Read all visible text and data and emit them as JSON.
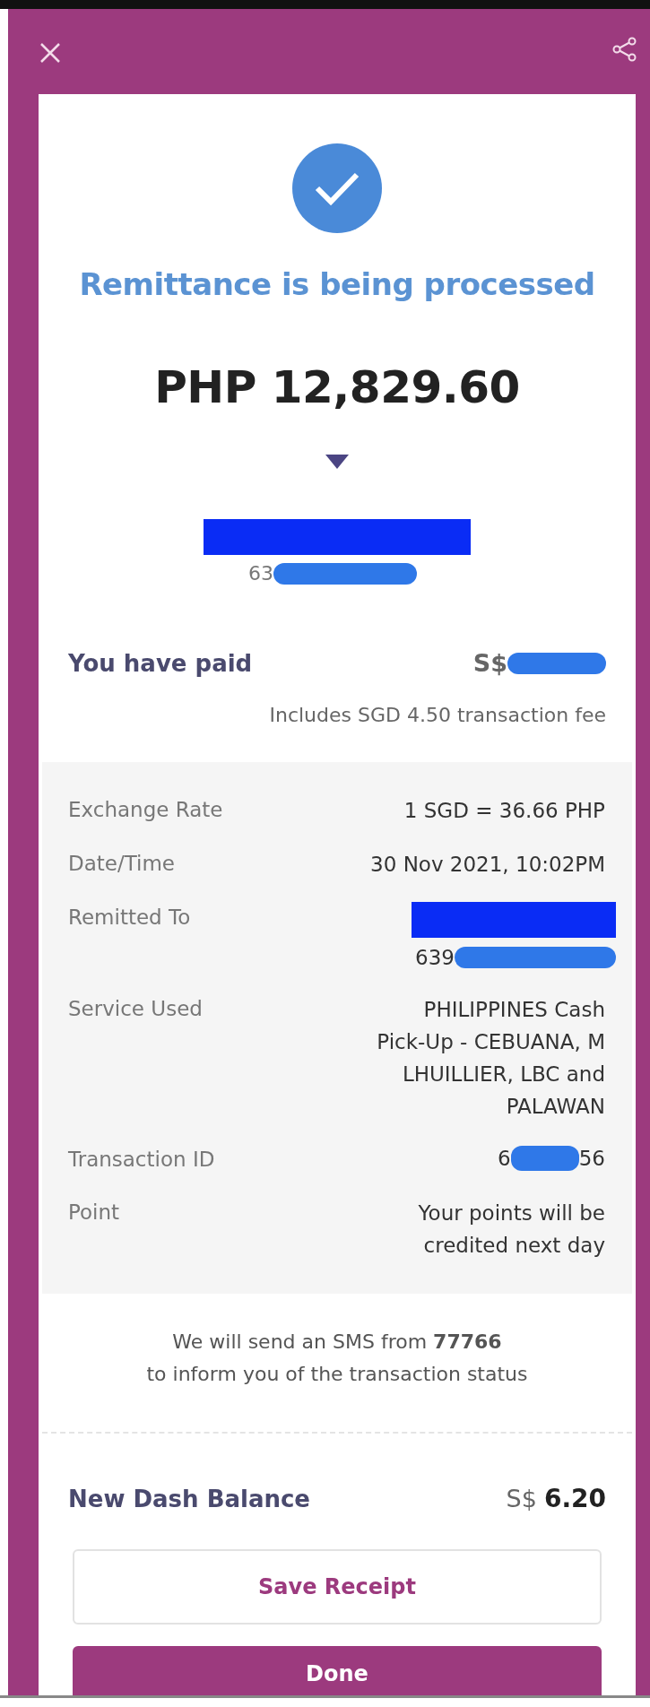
{
  "status": {
    "title": "Remittance is being processed",
    "amount": "PHP 12,829.60"
  },
  "recipient": {
    "phone_prefix": "63"
  },
  "payment": {
    "label": "You have paid",
    "currency": "S$",
    "note": "Includes SGD 4.50 transaction fee"
  },
  "details": [
    {
      "label": "Exchange Rate",
      "kind": "text",
      "value": "1 SGD = 36.66 PHP"
    },
    {
      "label": "Date/Time",
      "kind": "text",
      "value": "30 Nov 2021, 10:02PM"
    },
    {
      "label": "Remitted To",
      "kind": "redacted",
      "value": "639"
    },
    {
      "label": "Service Used",
      "kind": "text",
      "value": "PHILIPPINES Cash Pick-Up - CEBUANA, M LHUILLIER, LBC and PALAWAN"
    },
    {
      "label": "Transaction ID",
      "kind": "masked",
      "value_start": "6",
      "value_end": "56"
    },
    {
      "label": "Point",
      "kind": "text",
      "value": "Your points will be credited next day"
    }
  ],
  "sms_notice": {
    "lines": [
      "We will send an SMS from **77766**",
      "to inform you of the transaction status"
    ]
  },
  "balance": {
    "label": "New Dash Balance",
    "currency": "S$",
    "amount": "6.20"
  },
  "buttons": [
    {
      "label": "Save Receipt",
      "kind": "outline"
    },
    {
      "label": "Done",
      "kind": "primary"
    }
  ]
}
